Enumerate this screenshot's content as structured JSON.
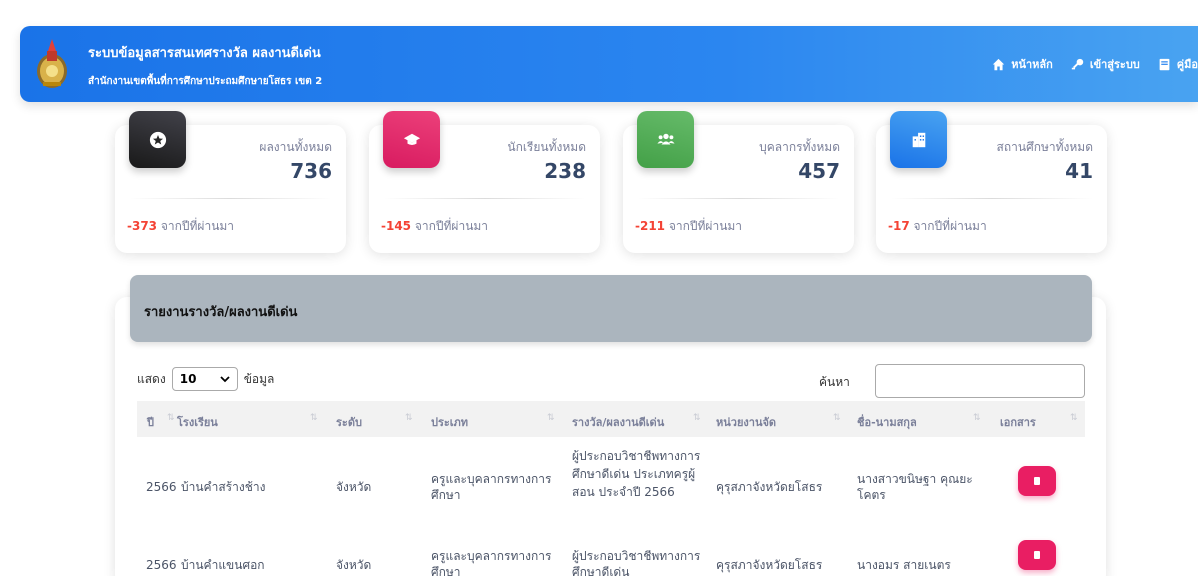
{
  "navbar": {
    "title": "ระบบข้อมูลสารสนเทศรางวัล ผลงานดีเด่น",
    "subtitle": "สำนักงานเขตพื้นที่การศึกษาประถมศึกษายโสธร เขต 2",
    "links": [
      {
        "label": "หน้าหลัก",
        "icon": "home-icon"
      },
      {
        "label": "เข้าสู่ระบบ",
        "icon": "key-icon"
      },
      {
        "label": "คู่มือ",
        "icon": "book-icon"
      }
    ]
  },
  "stats": [
    {
      "label": "ผลงานทั้งหมด",
      "value": "736",
      "delta": "-373",
      "delta_text": "จากปีที่ผ่านมา",
      "icon": "star-icon",
      "color": "#262626"
    },
    {
      "label": "นักเรียนทั้งหมด",
      "value": "238",
      "delta": "-145",
      "delta_text": "จากปีที่ผ่านมา",
      "icon": "graduation-cap-icon",
      "color": "#e91e63"
    },
    {
      "label": "บุคลากรทั้งหมด",
      "value": "457",
      "delta": "-211",
      "delta_text": "จากปีที่ผ่านมา",
      "icon": "users-icon",
      "color": "#4caf50"
    },
    {
      "label": "สถานศึกษาทั้งหมด",
      "value": "41",
      "delta": "-17",
      "delta_text": "จากปีที่ผ่านมา",
      "icon": "building-icon",
      "color": "#1a73e8"
    }
  ],
  "report": {
    "title": "รายงานรางวัล/ผลงานดีเด่น",
    "show_label": "แสดง",
    "page_size": "10",
    "records_label": "ข้อมูล",
    "search_label": "ค้นหา",
    "search_value": "",
    "columns": [
      "ปี",
      "โรงเรียน",
      "ระดับ",
      "ประเภท",
      "รางวัล/ผลงานดีเด่น",
      "หน่วยงานจัด",
      "ชื่อ-นามสกุล",
      "เอกสาร"
    ],
    "rows": [
      {
        "year": "2566",
        "school": "บ้านคำสร้างช้าง",
        "level": "จังหวัด",
        "type": "ครูและบุคลากรทางการศึกษา",
        "award": "ผู้ประกอบวิชาชีพทางการศึกษาดีเด่น ประเภทครูผู้สอน ประจำปี 2566",
        "organizer": "คุรุสภาจังหวัดยโสธร",
        "name": "นางสาวขนิษฐา คุณยะโคตร"
      },
      {
        "year": "2566",
        "school": "บ้านคำแขนศอก",
        "level": "จังหวัด",
        "type": "ครูและบุคลากรทางการศึกษา",
        "award": "ผู้ประกอบวิชาชีพทางการศึกษาดีเด่น",
        "organizer": "คุรุสภาจังหวัดยโสธร",
        "name": "นางอมร สายเนตร"
      }
    ]
  }
}
